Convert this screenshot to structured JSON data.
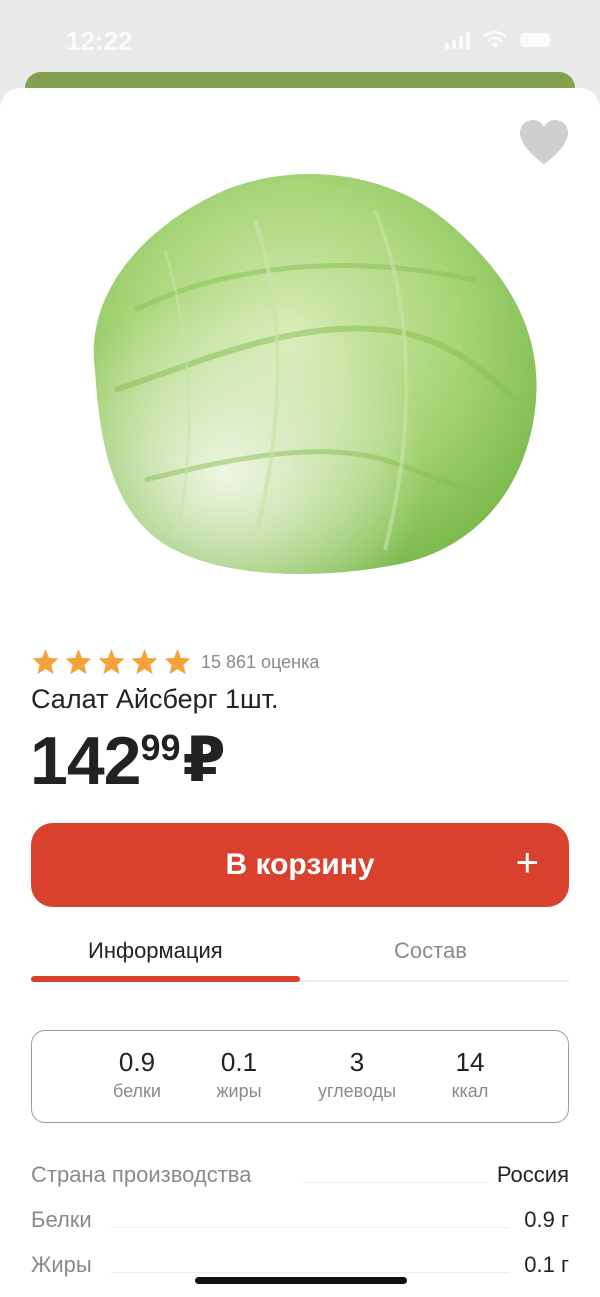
{
  "status_bar": {
    "time": "12:22"
  },
  "product": {
    "rating_count": "15 861 оценка",
    "rating_stars": 5,
    "title": "Салат Айсберг 1шт.",
    "price_main": "142",
    "price_cents": "99",
    "currency": "₽"
  },
  "cart": {
    "label": "В корзину",
    "plus": "+"
  },
  "tabs": {
    "info": "Информация",
    "composition": "Состав"
  },
  "nutrition": [
    {
      "value": "0.9",
      "label": "белки"
    },
    {
      "value": "0.1",
      "label": "жиры"
    },
    {
      "value": "3",
      "label": "углеводы"
    },
    {
      "value": "14",
      "label": "ккал"
    }
  ],
  "specs": [
    {
      "label": "Страна производства",
      "value": "Россия"
    },
    {
      "label": "Белки",
      "value": "0.9 г"
    },
    {
      "label": "Жиры",
      "value": "0.1 г"
    }
  ],
  "colors": {
    "accent": "#d9402e",
    "strip": "#84a24e",
    "star": "#f2a33a"
  },
  "icons": [
    "heart-icon",
    "star-icon",
    "plus-icon",
    "lettuce-image"
  ]
}
